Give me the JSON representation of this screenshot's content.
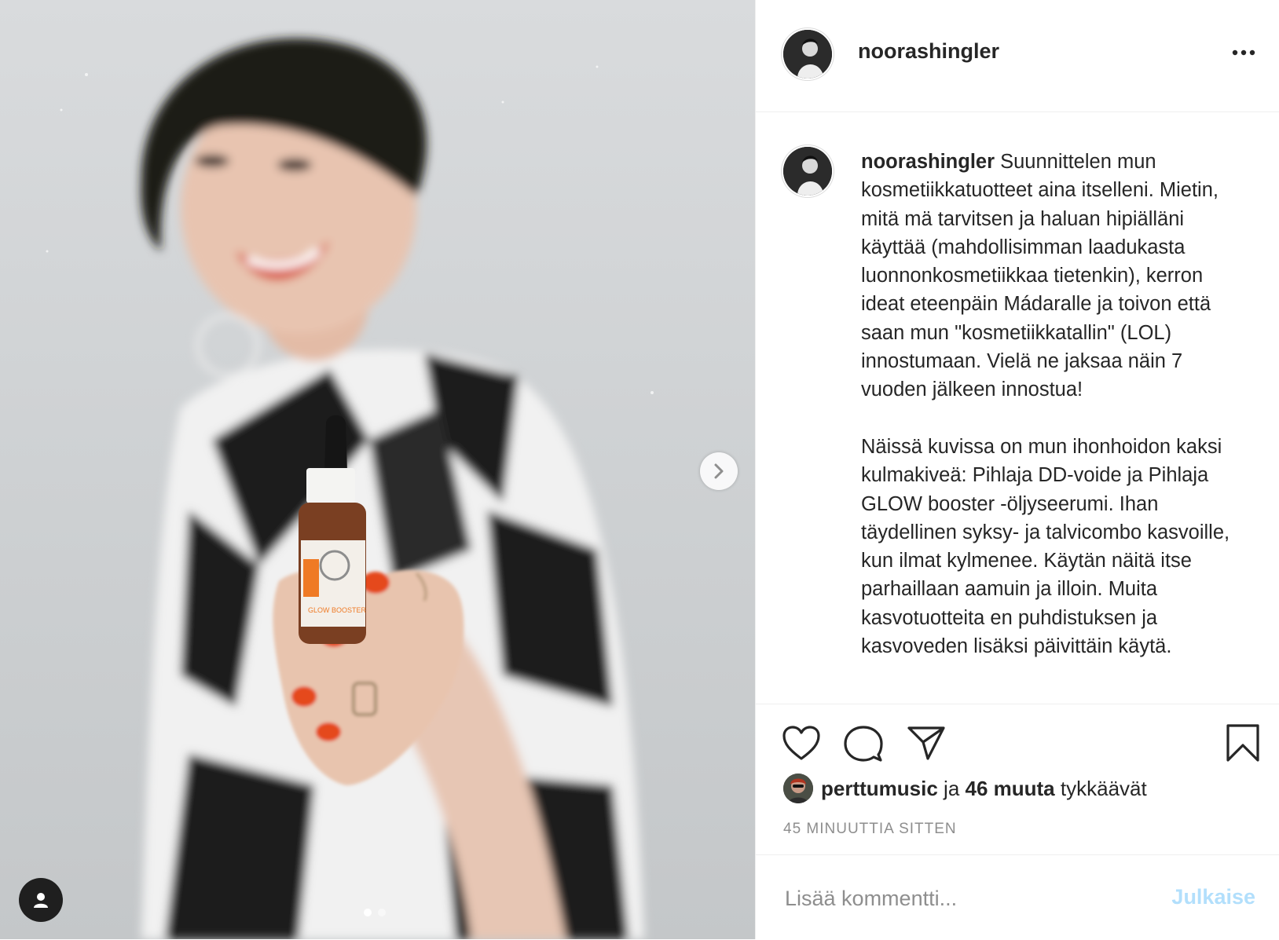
{
  "post": {
    "username": "noorashingler",
    "caption_user": "noorashingler",
    "caption_text": " Suunnittelen mun kosmetiikkatuotteet aina itselleni. Mietin, mitä mä tarvitsen ja haluan hipiälläni käyttää (mahdollisimman laadukasta luonnonkosmetiikkaa tietenkin), kerron ideat eteenpäin Mádaralle ja toivon että saan mun \"kosmetiikkatallin\" (LOL) innostumaan. Vielä ne jaksaa näin 7 vuoden jälkeen innostua!\n\nNäissä kuvissa on mun ihonhoidon kaksi kulmakiveä: Pihlaja DD-voide ja Pihlaja GLOW booster -öljyseerumi. Ihan täydellinen syksy- ja talvicombo kasvoille, kun ilmat kylmenee. Käytän näitä itse parhaillaan aamuin ja illoin. Muita kasvotuotteita en puhdistuksen ja kasvoveden lisäksi päivittäin käytä.",
    "likes": {
      "liker": "perttumusic",
      "connector": " ja ",
      "count_text": "46 muuta",
      "suffix": " tykkäävät"
    },
    "timestamp": "45 minuuttia sitten"
  },
  "carousel": {
    "slides": 2,
    "active": 0
  },
  "comment": {
    "placeholder": "Lisää kommentti...",
    "post_label": "Julkaise"
  },
  "icons": {
    "more": "more-options-icon",
    "next": "chevron-right-icon",
    "tag": "user-tag-icon",
    "like": "heart-icon",
    "comment": "comment-icon",
    "share": "share-icon",
    "save": "bookmark-icon"
  },
  "colors": {
    "accent_disabled": "#b2dffc",
    "text": "#262626",
    "muted": "#8e8e8e",
    "divider": "#efefef"
  }
}
